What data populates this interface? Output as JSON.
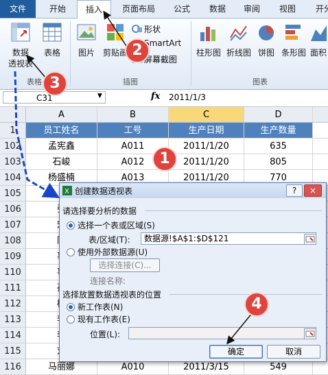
{
  "ribbon": {
    "tabs": [
      {
        "label": "文件"
      },
      {
        "label": "开始"
      },
      {
        "label": "插入"
      },
      {
        "label": "页面布局"
      },
      {
        "label": "公式"
      },
      {
        "label": "数据"
      },
      {
        "label": "审阅"
      },
      {
        "label": "视图"
      },
      {
        "label": "开分"
      }
    ],
    "pivot_label_1": "数据",
    "pivot_label_2": "透视表",
    "table_label": "表格",
    "picture_label": "图片",
    "clipart_label": "剪贴画",
    "shapes_label": "形状",
    "smartart_label": "SmartArt",
    "screenshot_label": "屏幕截图",
    "column_chart_label": "柱形图",
    "line_chart_label": "折线图",
    "pie_chart_label": "饼图",
    "bar_chart_label": "条形图",
    "area_chart_label": "面积",
    "group_tables": "表格",
    "group_illustrations": "插图",
    "group_charts": "图表"
  },
  "formula_bar": {
    "name_box": "C31",
    "fx": "fx",
    "value": "2011/1/3"
  },
  "grid": {
    "columns": [
      "A",
      "B",
      "C",
      "D"
    ],
    "rows": [
      {
        "num": "1",
        "cells": [
          "员工姓名",
          "工号",
          "生产日期",
          "生产数量"
        ]
      },
      {
        "num": "102",
        "cells": [
          "孟宪鑫",
          "A011",
          "2011/1/20",
          "635"
        ]
      },
      {
        "num": "103",
        "cells": [
          "石峻",
          "A012",
          "2011/1/20",
          "805"
        ]
      },
      {
        "num": "104",
        "cells": [
          "杨盛楠",
          "A013",
          "2011/1/20",
          "770"
        ]
      },
      {
        "num": "105",
        "cells": [
          "",
          "",
          "",
          ""
        ]
      },
      {
        "num": "106",
        "cells": [
          "张",
          "",
          "",
          ""
        ]
      },
      {
        "num": "107",
        "cells": [
          "宋",
          "",
          "",
          ""
        ]
      },
      {
        "num": "108",
        "cells": [
          "阿",
          "",
          "",
          ""
        ]
      },
      {
        "num": "109",
        "cells": [
          "事",
          "",
          "",
          ""
        ]
      },
      {
        "num": "110",
        "cells": [
          "事",
          "",
          "",
          ""
        ]
      },
      {
        "num": "111",
        "cells": [
          "孙",
          "",
          "",
          ""
        ]
      },
      {
        "num": "112",
        "cells": [
          "杨",
          "",
          "",
          ""
        ]
      },
      {
        "num": "113",
        "cells": [
          "李",
          "",
          "",
          ""
        ]
      },
      {
        "num": "114",
        "cells": [
          "李",
          "",
          "",
          ""
        ]
      },
      {
        "num": "115",
        "cells": [
          "刘",
          "",
          "",
          ""
        ]
      },
      {
        "num": "116",
        "cells": [
          "马丽娜",
          "A010",
          "2011/3/15",
          "549"
        ]
      }
    ]
  },
  "dialog": {
    "title": "创建数据透视表",
    "help": "?",
    "close": "×",
    "section1": "请选择要分析的数据",
    "opt_range": "选择一个表或区域(S)",
    "range_label": "表/区域(T):",
    "range_value": "数据源!$A$1:$D$121",
    "opt_external": "使用外部数据源(U)",
    "choose_conn": "选择连接(C)...",
    "conn_name": "连接名称:",
    "section2": "选择放置数据透视表的位置",
    "opt_new_sheet": "新工作表(N)",
    "opt_existing": "现有工作表(E)",
    "location_label": "位置(L):",
    "location_value": "",
    "ok": "确定",
    "cancel": "取消"
  },
  "annotations": {
    "n1": "1",
    "n2": "2",
    "n3": "3",
    "n4": "4"
  },
  "colors": {
    "header_blue": "#4f81bd",
    "selected_col": "#f8d878",
    "file_tab": "#1f5d9e",
    "badge_red": "#e0433b",
    "arrow_blue": "#1a44c8"
  }
}
